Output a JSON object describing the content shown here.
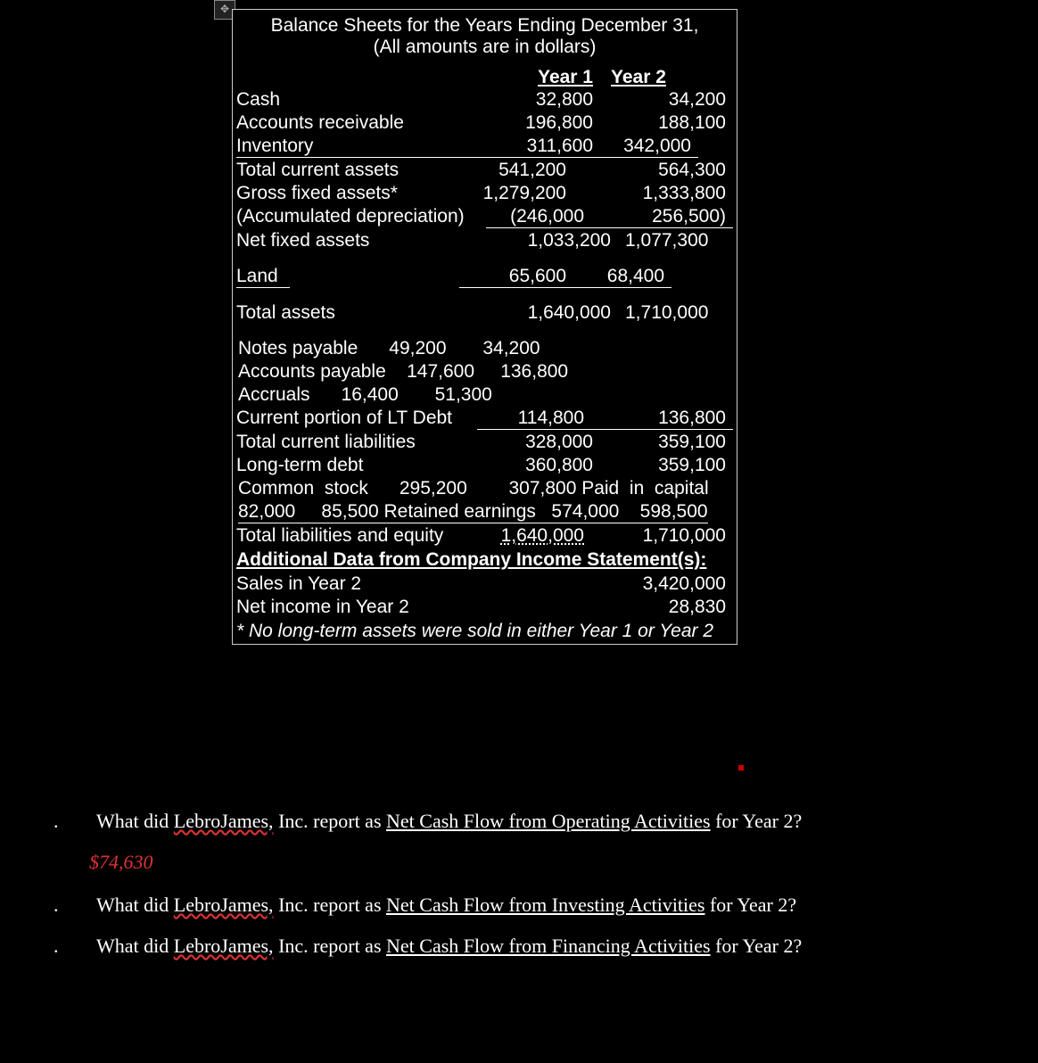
{
  "chart_data": {
    "type": "table",
    "title": "Balance Sheets for the Years Ending December 31, (All amounts are in dollars)",
    "columns": [
      "Item",
      "Year 1",
      "Year 2"
    ],
    "rows": [
      [
        "Cash",
        32800,
        34200
      ],
      [
        "Accounts receivable",
        196800,
        188100
      ],
      [
        "Inventory",
        311600,
        342000
      ],
      [
        "Total current assets",
        541200,
        564300
      ],
      [
        "Gross fixed assets*",
        1279200,
        1333800
      ],
      [
        "(Accumulated depreciation)",
        246000,
        256500
      ],
      [
        "Net fixed assets",
        1033200,
        1077300
      ],
      [
        "Land",
        65600,
        68400
      ],
      [
        "Total assets",
        1640000,
        1710000
      ],
      [
        "Notes payable",
        49200,
        34200
      ],
      [
        "Accounts payable",
        147600,
        136800
      ],
      [
        "Accruals",
        16400,
        51300
      ],
      [
        "Current portion of LT Debt",
        114800,
        136800
      ],
      [
        "Total current liabilities",
        328000,
        359100
      ],
      [
        "Long-term debt",
        360800,
        359100
      ],
      [
        "Common stock",
        295200,
        307800
      ],
      [
        "Paid in capital",
        82000,
        85500
      ],
      [
        "Retained earnings",
        574000,
        598500
      ],
      [
        "Total liabilities and equity",
        1640000,
        1710000
      ]
    ],
    "additional": {
      "Sales in Year 2": 3420000,
      "Net income in Year 2": 28830
    },
    "footnote": "* No long-term assets were sold in either Year 1 or Year 2"
  },
  "title1": "Balance Sheets for the Years Ending December 31,",
  "title2": "(All amounts are in dollars)",
  "hdr_y1": "Year 1",
  "hdr_y2": "Year 2",
  "rows": {
    "cash": {
      "label": "Cash",
      "y1": "32,800",
      "y2": "34,200"
    },
    "ar": {
      "label": "Accounts receivable",
      "y1": "196,800",
      "y2": "188,100"
    },
    "inv": {
      "label": "Inventory",
      "y1": "311,600",
      "y2": "342,000"
    },
    "tca": {
      "label": "Total current assets",
      "y1": "541,200",
      "y2": "564,300"
    },
    "gfa": {
      "label": "Gross fixed assets*",
      "y1": "1,279,200",
      "y2": "1,333,800"
    },
    "ad": {
      "label": "(Accumulated depreciation)",
      "y1": "(246,000",
      "y2": "256,500)"
    },
    "nfa": {
      "label": "Net fixed assets",
      "y1": "1,033,200",
      "y2": "1,077,300"
    },
    "land": {
      "label": "Land",
      "y1": "65,600",
      "y2": "68,400"
    },
    "ta": {
      "label": "Total assets",
      "y1": "1,640,000",
      "y2": "1,710,000"
    },
    "np_free": "Notes payable      49,200       34,200",
    "ap_free": "Accounts payable    147,600     136,800",
    "acc_free": "Accruals      16,400       51,300",
    "cplt": {
      "label": "Current portion of LT Debt",
      "y1": "114,800",
      "y2": "136,800"
    },
    "tcl": {
      "label": "  Total current liabilities",
      "y1": "328,000",
      "y2": "359,100"
    },
    "ltd": {
      "label": "Long-term debt",
      "y1": "360,800",
      "y2": "359,100"
    },
    "cs_free": "Common  stock      295,200        307,800 Paid  in  capital",
    "re_free": "82,000     85,500 Retained earnings   574,000    598,500",
    "tle": {
      "label": "  Total liabilities and equity",
      "y1": "1,640,000",
      "y2": "1,710,000"
    }
  },
  "add_title": "Additional Data from Company Income Statement(s):",
  "add_sales": {
    "label": "Sales in Year 2",
    "val": "3,420,000"
  },
  "add_ni": {
    "label": "Net income in Year 2",
    "val": "28,830"
  },
  "footnote": "* No long-term assets were sold in either Year 1 or Year 2",
  "questions": {
    "prefix": "What did ",
    "company": "LebroJames,",
    "mid": " Inc. report as ",
    "q1_key": "Net Cash Flow from Operating Activities",
    "q2_key": "Net Cash Flow from Investing Activities",
    "q3_key": "Net Cash Flow from Financing Activities",
    "suffix": " for Year 2?",
    "ans1": "$74,630"
  },
  "move_glyph": "✥"
}
